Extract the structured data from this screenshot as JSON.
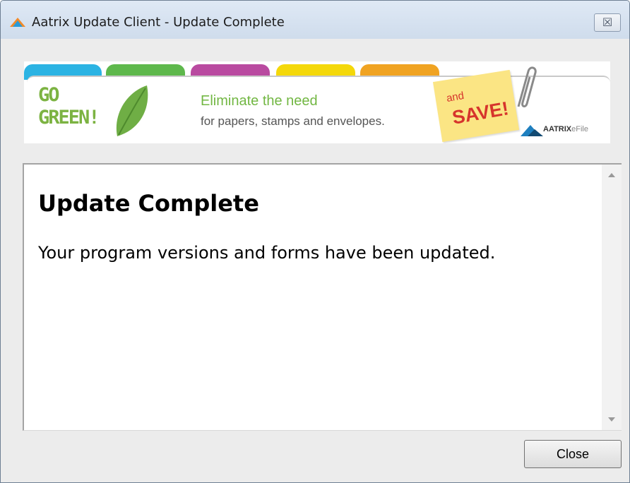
{
  "window": {
    "title": "Aatrix Update Client - Update Complete",
    "close_glyph": "☒"
  },
  "banner": {
    "go_green": "GO",
    "go_green2": "GREEN!",
    "headline": "Eliminate the need",
    "subline": "for papers, stamps and envelopes.",
    "and": "and",
    "save": "SAVE!",
    "brand": "AATRIX",
    "brand_suffix": "eFile",
    "tab_colors": [
      "#2bb3e3",
      "#5eb84c",
      "#b94aa0",
      "#f4d80a",
      "#f0a322"
    ]
  },
  "content": {
    "heading": "Update Complete",
    "message": "Your program versions and forms have been updated."
  },
  "footer": {
    "close_label": "Close"
  }
}
